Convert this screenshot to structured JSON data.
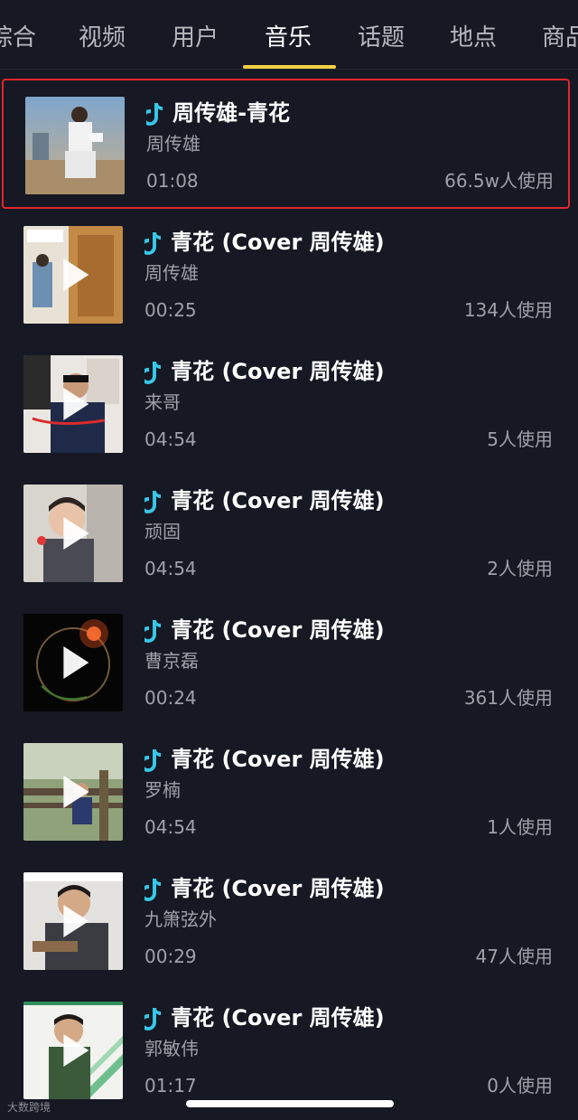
{
  "tabs": [
    {
      "label": "综合",
      "active": false
    },
    {
      "label": "视频",
      "active": false
    },
    {
      "label": "用户",
      "active": false
    },
    {
      "label": "音乐",
      "active": true
    },
    {
      "label": "话题",
      "active": false
    },
    {
      "label": "地点",
      "active": false
    },
    {
      "label": "商品",
      "active": false
    }
  ],
  "accent_color": "#f5d142",
  "highlight_color": "#e3262d",
  "music_note_color": "#38c7e6",
  "results": [
    {
      "title": "周传雄-青花",
      "artist": "周传雄",
      "duration": "01:08",
      "usage": "66.5w人使用",
      "selected": true,
      "has_play": false
    },
    {
      "title": "青花 (Cover 周传雄)",
      "artist": "周传雄",
      "duration": "00:25",
      "usage": "134人使用",
      "selected": false,
      "has_play": true
    },
    {
      "title": "青花 (Cover 周传雄)",
      "artist": "来哥",
      "duration": "04:54",
      "usage": "5人使用",
      "selected": false,
      "has_play": true
    },
    {
      "title": "青花 (Cover 周传雄)",
      "artist": "顽固",
      "duration": "04:54",
      "usage": "2人使用",
      "selected": false,
      "has_play": true
    },
    {
      "title": "青花 (Cover 周传雄)",
      "artist": "曹京磊",
      "duration": "00:24",
      "usage": "361人使用",
      "selected": false,
      "has_play": true
    },
    {
      "title": "青花 (Cover 周传雄)",
      "artist": "罗楠",
      "duration": "04:54",
      "usage": "1人使用",
      "selected": false,
      "has_play": true
    },
    {
      "title": "青花 (Cover 周传雄)",
      "artist": "九箫弦外",
      "duration": "00:29",
      "usage": "47人使用",
      "selected": false,
      "has_play": true
    },
    {
      "title": "青花 (Cover 周传雄)",
      "artist": "郭敏伟",
      "duration": "01:17",
      "usage": "0人使用",
      "selected": false,
      "has_play": true
    }
  ],
  "watermark": "大数跨境"
}
